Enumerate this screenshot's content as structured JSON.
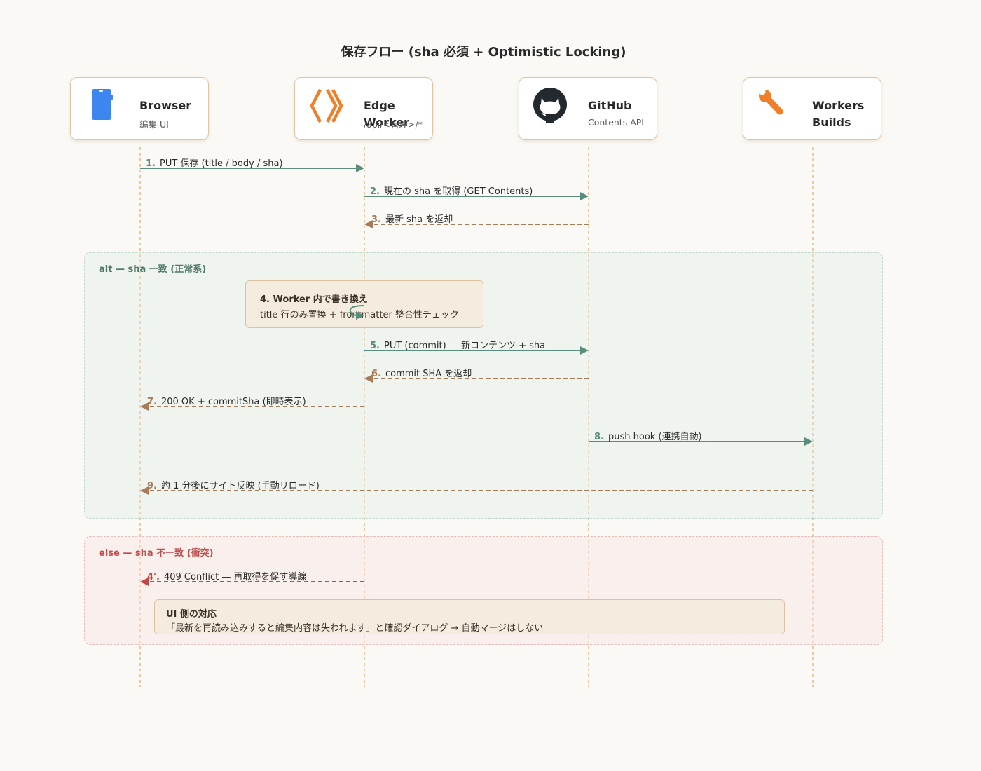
{
  "title": "保存フロー (sha 必須 + Optimistic Locking)",
  "participants": [
    {
      "name": "Browser",
      "sub": "編集 UI",
      "icon": "phone-icon"
    },
    {
      "name": "Edge Worker",
      "sub": "/api/<管理>/*",
      "icon": "cloudflare-workers-icon"
    },
    {
      "name": "GitHub",
      "sub": "Contents API",
      "icon": "github-icon"
    },
    {
      "name": "Workers\nBuilds",
      "sub": "",
      "icon": "wrench-icon"
    }
  ],
  "messages": [
    {
      "num": "1.",
      "text": "PUT 保存 (title / body / sha)"
    },
    {
      "num": "2.",
      "text": "現在の sha を取得 (GET Contents)"
    },
    {
      "num": "3.",
      "text": "最新 sha を返却"
    },
    {
      "num": "5.",
      "text": "PUT (commit) — 新コンテンツ + sha"
    },
    {
      "num": "6.",
      "text": "commit SHA を返却"
    },
    {
      "num": "7.",
      "text": "200 OK + commitSha (即時表示)"
    },
    {
      "num": "8.",
      "text": "push hook (連携自動)"
    },
    {
      "num": "9.",
      "text": "約 1 分後にサイト反映 (手動リロード)"
    },
    {
      "num": "4'.",
      "text": "409 Conflict — 再取得を促す導線"
    }
  ],
  "frames": {
    "alt_label": "alt — sha 一致 (正常系)",
    "else_label": "else — sha 不一致 (衝突)"
  },
  "notes": {
    "worker_title": "4. Worker 内で書き換え",
    "worker_body": "title 行のみ置換 + frontmatter 整合性チェック",
    "ui_title": "UI 側の対応",
    "ui_body": "「最新を再読み込みすると編集内容は失われます」と確認ダイアログ → 自動マージはしない"
  },
  "colors": {
    "request": "#5a8d7c",
    "response": "#a87c5a",
    "conflict": "#c04848",
    "lifeline": "#e8b88a"
  }
}
